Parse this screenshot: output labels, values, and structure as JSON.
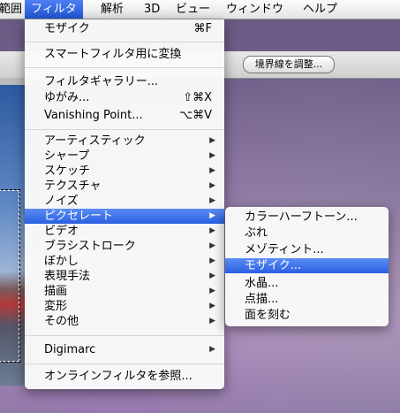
{
  "menubar": {
    "items": [
      {
        "label": "範囲",
        "active": false
      },
      {
        "label": "フィルタ",
        "active": true
      },
      {
        "label": "解析",
        "active": false
      },
      {
        "label": "3D",
        "active": false
      },
      {
        "label": "ビュー",
        "active": false
      },
      {
        "label": "ウィンドウ",
        "active": false
      },
      {
        "label": "ヘルプ",
        "active": false
      }
    ]
  },
  "options_bar": {
    "refine_edge_button": "境界線を調整..."
  },
  "filter_menu": {
    "last_filter": {
      "label": "モザイク",
      "shortcut": "⌘F"
    },
    "convert_smart": "スマートフィルタ用に変換",
    "filter_gallery": "フィルタギャラリー...",
    "liquify": {
      "label": "ゆがみ...",
      "shortcut": "⇧⌘X"
    },
    "vanishing_point": {
      "label": "Vanishing Point...",
      "shortcut": "⌥⌘V"
    },
    "categories": [
      "アーティスティック",
      "シャープ",
      "スケッチ",
      "テクスチャ",
      "ノイズ",
      "ピクセレート",
      "ビデオ",
      "ブラシストローク",
      "ぼかし",
      "表現手法",
      "描画",
      "変形",
      "その他"
    ],
    "highlighted_category": "ピクセレート",
    "digimarc": "Digimarc",
    "browse_online": "オンラインフィルタを参照..."
  },
  "pixelate_submenu": {
    "items": [
      "カラーハーフトーン...",
      "ぶれ",
      "メゾティント...",
      "モザイク...",
      "水晶...",
      "点描...",
      "面を刻む"
    ],
    "highlighted": "モザイク..."
  },
  "colors": {
    "highlight": "#2a5fe0",
    "menu_bg": "#fafafa"
  }
}
